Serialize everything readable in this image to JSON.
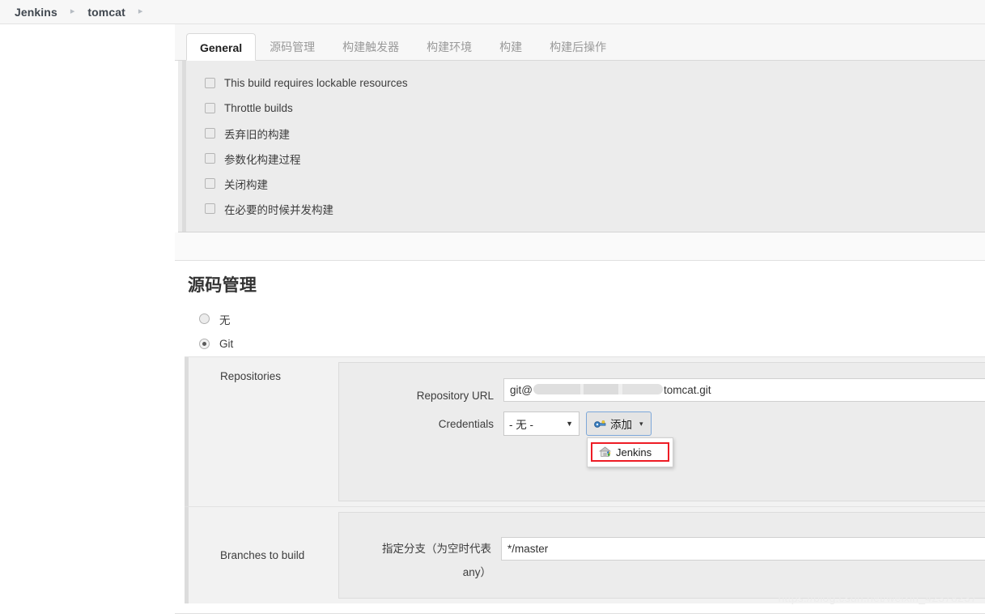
{
  "breadcrumb": {
    "items": [
      {
        "label": "Jenkins"
      },
      {
        "label": "tomcat"
      }
    ],
    "separator": "▸"
  },
  "tabs": [
    {
      "label": "General",
      "active": true
    },
    {
      "label": "源码管理",
      "active": false
    },
    {
      "label": "构建触发器",
      "active": false
    },
    {
      "label": "构建环境",
      "active": false
    },
    {
      "label": "构建",
      "active": false
    },
    {
      "label": "构建后操作",
      "active": false
    }
  ],
  "general": {
    "checkboxes": [
      {
        "label": "This build requires lockable resources",
        "checked": false
      },
      {
        "label": "Throttle builds",
        "checked": false
      },
      {
        "label": "丢弃旧的构建",
        "checked": false
      },
      {
        "label": "参数化构建过程",
        "checked": false
      },
      {
        "label": "关闭构建",
        "checked": false
      },
      {
        "label": "在必要的时候并发构建",
        "checked": false
      }
    ]
  },
  "scm": {
    "section_title": "源码管理",
    "radios": [
      {
        "label": "无",
        "checked": false
      },
      {
        "label": "Git",
        "checked": true
      }
    ],
    "repositories": {
      "label": "Repositories",
      "repository_url": {
        "label": "Repository URL",
        "value_prefix": "git@",
        "value_suffix": "tomcat.git",
        "masked": true
      },
      "credentials": {
        "label": "Credentials",
        "selected": "- 无 -",
        "options": [
          "- 无 -"
        ],
        "add_button": {
          "label": "添加",
          "icon": "key-icon",
          "caret": "▾",
          "open": true,
          "menu_items": [
            {
              "label": "Jenkins",
              "icon": "jenkins-house-icon",
              "highlighted": true
            }
          ]
        }
      }
    },
    "branches": {
      "label": "Branches to build",
      "branch_spec": {
        "label": "指定分支（为空时代表any）",
        "value": "*/master"
      }
    }
  },
  "watermark": {
    "text": "https://blog.csdn.net/weixin_42378237"
  },
  "colors": {
    "accent_blue": "#7da7d9",
    "highlight_red": "#ee1c25",
    "panel_gray": "#ececec",
    "page_bg": "#ffffff"
  }
}
